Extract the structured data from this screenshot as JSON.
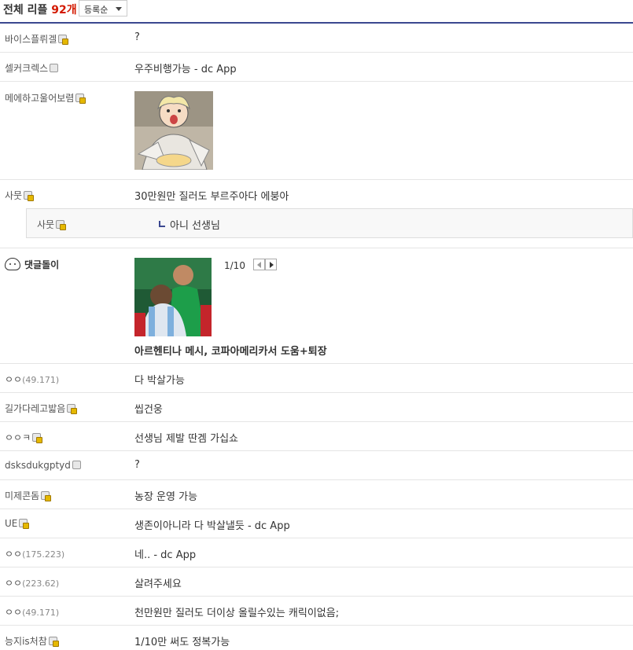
{
  "header": {
    "title_prefix": "전체 리플",
    "count": "92개",
    "sort_label": "등록순"
  },
  "comments": [
    {
      "nick": "바이스플뤼겔",
      "content": "?"
    },
    {
      "nick": "셀커크렉스",
      "content": "우주비행가능 - dc App"
    },
    {
      "nick": "메에하고울어보렴",
      "content": ""
    },
    {
      "nick": "사뭇",
      "content": "30만원만 질러도 부르주아다 에붕아"
    },
    {
      "nick": "사뭇",
      "content": "아니 선생님"
    },
    {
      "nick": "ㅇㅇ",
      "ip": "(49.171)",
      "content": "다 박살가능"
    },
    {
      "nick": "길가다레고밟음",
      "content": "씹건웅"
    },
    {
      "nick": "ㅇㅇㅋ",
      "content": "선생님 제발 딴겜 가십쇼"
    },
    {
      "nick": "dsksdukgptyd",
      "content": "?"
    },
    {
      "nick": "미제콘돔",
      "content": "농장 운영 가능"
    },
    {
      "nick": "UE",
      "content": "생존이아니라 다 박살낼듯 - dc App"
    },
    {
      "nick": "ㅇㅇ",
      "ip": "(175.223)",
      "content": "네.. - dc App"
    },
    {
      "nick": "ㅇㅇ",
      "ip": "(223.62)",
      "content": "살려주세요"
    },
    {
      "nick": "ㅇㅇ",
      "ip": "(49.171)",
      "content": "천만원만 질러도 더이상 올릴수있는 캐릭이없음;"
    },
    {
      "nick": "능지is처참",
      "content": "1/10만 써도 정복가능"
    }
  ],
  "bot": {
    "name": "댓글돌이",
    "pager": "1/10",
    "news_title": "아르헨티나 메시, 코파아메리카서 도움+퇴장"
  },
  "colors": {
    "accent": "#3b4890",
    "count_red": "#d31900"
  }
}
